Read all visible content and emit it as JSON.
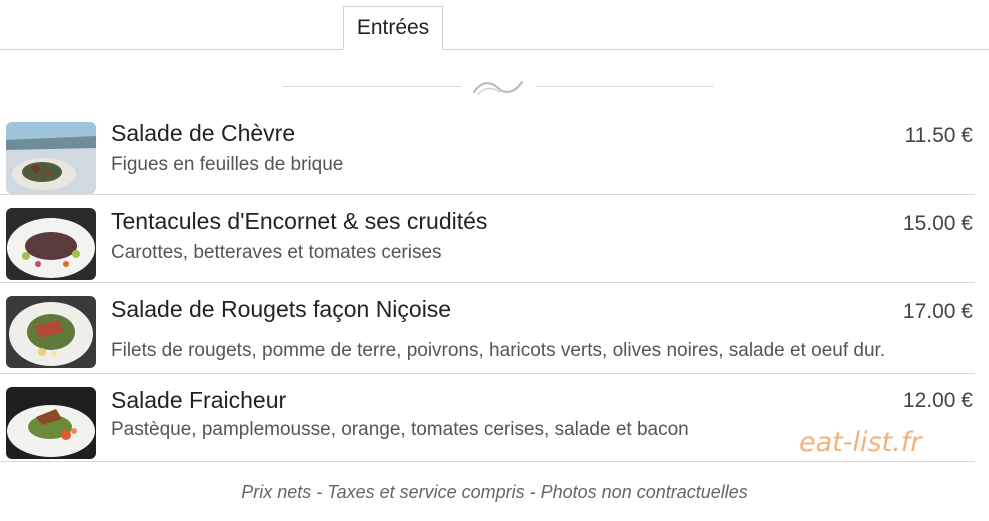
{
  "tabs": [
    {
      "label": "Entrées",
      "active": true
    }
  ],
  "menu": {
    "items": [
      {
        "name": "Salade de Chèvre",
        "description": "Figues en feuilles de brique",
        "price": "11.50 €"
      },
      {
        "name": "Tentacules d'Encornet & ses crudités",
        "description": "Carottes, betteraves et tomates cerises",
        "price": "15.00 €"
      },
      {
        "name": "Salade de Rougets façon Niçoise",
        "description": "Filets de rougets, pomme de terre, poivrons, haricots verts, olives noires, salade et oeuf dur.",
        "price": "17.00 €"
      },
      {
        "name": "Salade Fraicheur",
        "description": "Pastèque, pamplemousse, orange, tomates cerises, salade et bacon",
        "price": "12.00 €"
      }
    ]
  },
  "watermark": "eat-list.fr",
  "footer": {
    "note": "Prix nets - Taxes et service compris - Photos non contractuelles"
  },
  "colors": {
    "watermark": "#f2b27a",
    "divider": "#d9d9d9",
    "text": "#222222"
  }
}
